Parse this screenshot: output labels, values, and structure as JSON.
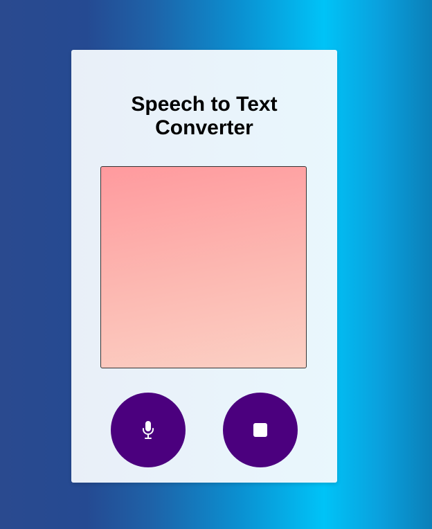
{
  "app": {
    "title": "Speech to Text Converter"
  },
  "transcript": {
    "value": ""
  },
  "controls": {
    "start_icon": "microphone-icon",
    "stop_icon": "stop-icon",
    "button_color": "#4b007e"
  },
  "colors": {
    "panel_gradient": [
      "#ff9a9e",
      "#fbd0c4"
    ]
  }
}
